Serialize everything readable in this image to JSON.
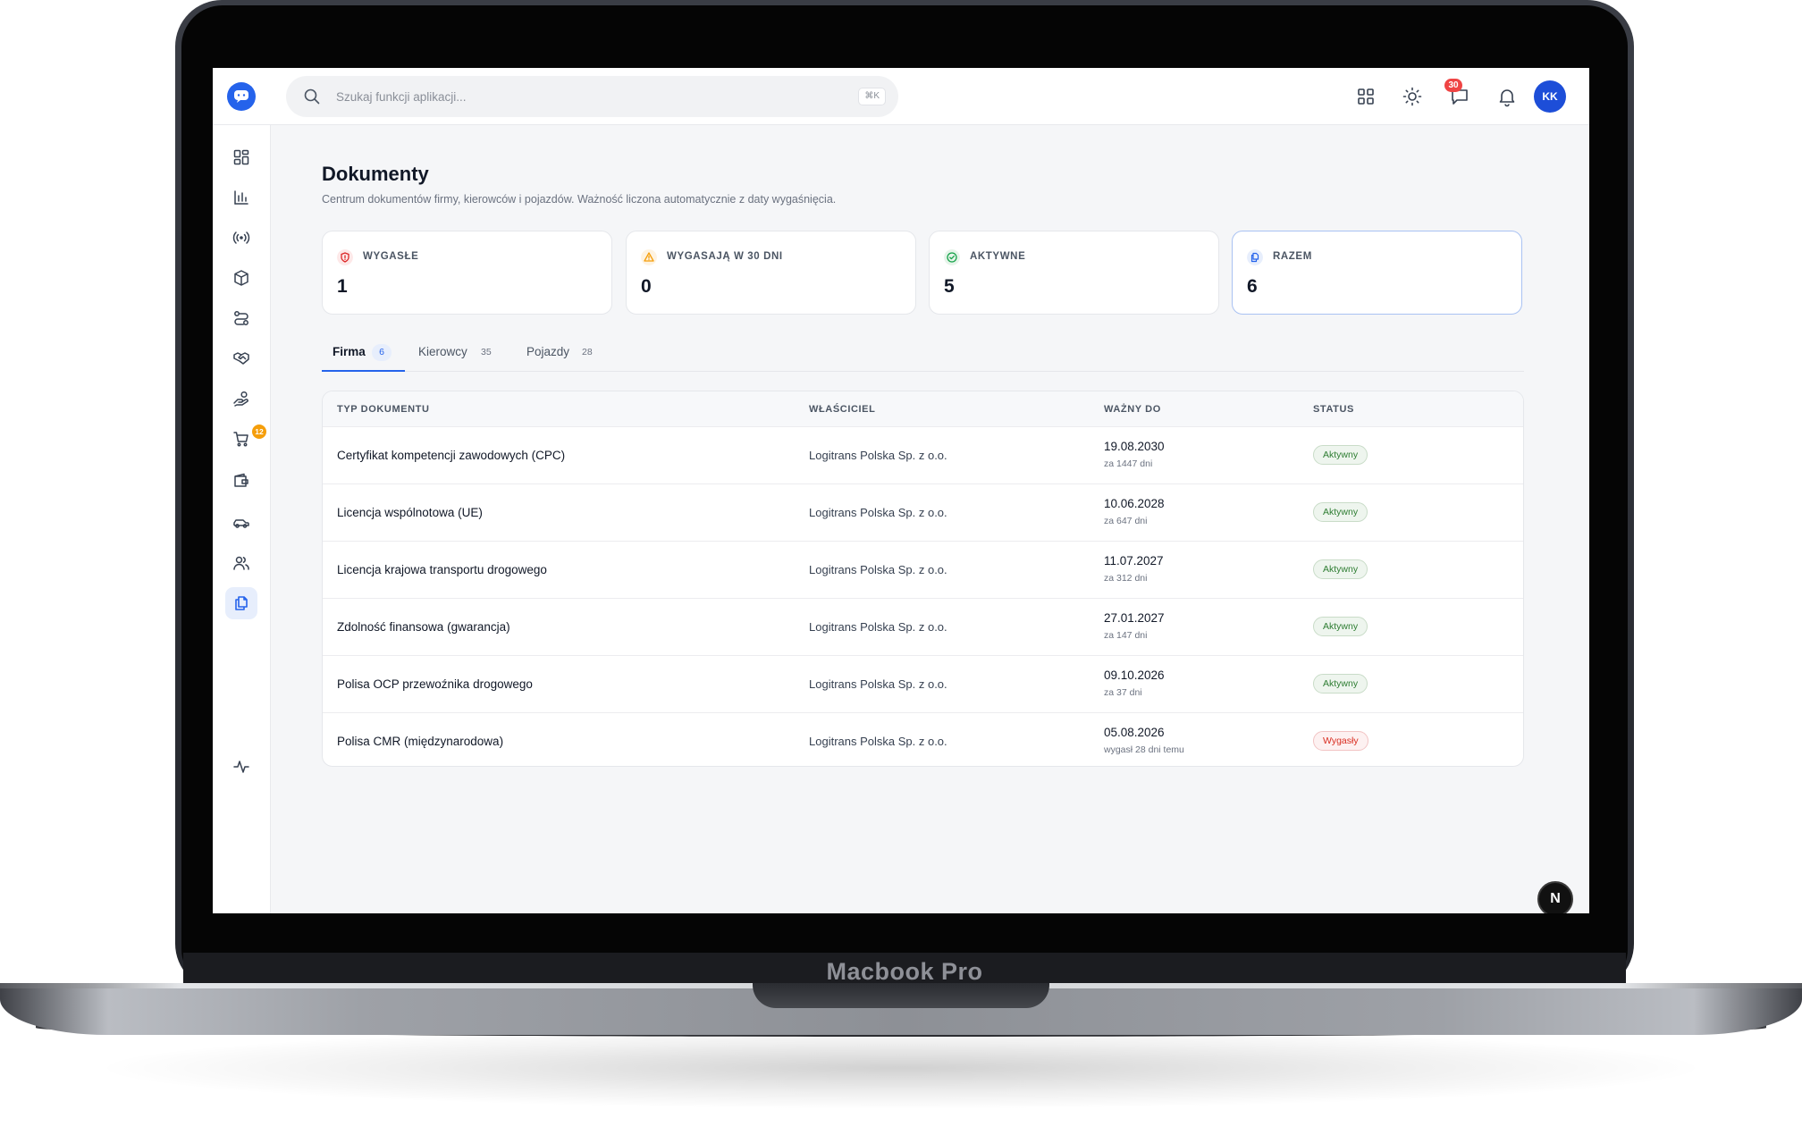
{
  "device": {
    "label": "Macbook Pro"
  },
  "search": {
    "placeholder": "Szukaj funkcji aplikacji...",
    "shortcut": "⌘K"
  },
  "header": {
    "notifications_count": "30",
    "avatar_initials": "KK"
  },
  "sidebar": {
    "items": [
      {
        "icon": "dashboard-grid-icon"
      },
      {
        "icon": "bar-chart-icon"
      },
      {
        "icon": "broadcast-icon"
      },
      {
        "icon": "package-icon"
      },
      {
        "icon": "route-icon"
      },
      {
        "icon": "handshake-icon"
      },
      {
        "icon": "hand-coins-icon"
      },
      {
        "icon": "cart-icon",
        "badge": "12"
      },
      {
        "icon": "wallet-icon"
      },
      {
        "icon": "car-icon"
      },
      {
        "icon": "users-icon"
      },
      {
        "icon": "documents-icon",
        "active": true
      },
      {
        "icon": "activity-icon"
      }
    ]
  },
  "page": {
    "title": "Dokumenty",
    "subtitle": "Centrum dokumentów firmy, kierowców i pojazdów. Ważność liczona automatycznie z daty wygaśnięcia."
  },
  "stats": [
    {
      "label": "WYGASŁE",
      "value": "1",
      "color": "#dc2626",
      "icon": "shield-alert-icon"
    },
    {
      "label": "WYGASAJĄ W 30 DNI",
      "value": "0",
      "color": "#f59e0b",
      "icon": "warning-icon"
    },
    {
      "label": "AKTYWNE",
      "value": "5",
      "color": "#16a34a",
      "icon": "check-circle-icon"
    },
    {
      "label": "RAZEM",
      "value": "6",
      "color": "#2563eb",
      "icon": "files-icon"
    }
  ],
  "tabs": [
    {
      "label": "Firma",
      "count": "6",
      "active": true
    },
    {
      "label": "Kierowcy",
      "count": "35"
    },
    {
      "label": "Pojazdy",
      "count": "28"
    }
  ],
  "table": {
    "columns": [
      "TYP DOKUMENTU",
      "WŁAŚCICIEL",
      "WAŻNY DO",
      "STATUS"
    ],
    "rows": [
      {
        "type": "Certyfikat kompetencji zawodowych (CPC)",
        "owner": "Logitrans Polska Sp. z o.o.",
        "date": "19.08.2030",
        "rel": "za 1447 dni",
        "status": "Aktywny"
      },
      {
        "type": "Licencja wspólnotowa (UE)",
        "owner": "Logitrans Polska Sp. z o.o.",
        "date": "10.06.2028",
        "rel": "za 647 dni",
        "status": "Aktywny"
      },
      {
        "type": "Licencja krajowa transportu drogowego",
        "owner": "Logitrans Polska Sp. z o.o.",
        "date": "11.07.2027",
        "rel": "za 312 dni",
        "status": "Aktywny"
      },
      {
        "type": "Zdolność finansowa (gwarancja)",
        "owner": "Logitrans Polska Sp. z o.o.",
        "date": "27.01.2027",
        "rel": "za 147 dni",
        "status": "Aktywny"
      },
      {
        "type": "Polisa OCP przewoźnika drogowego",
        "owner": "Logitrans Polska Sp. z o.o.",
        "date": "09.10.2026",
        "rel": "za 37 dni",
        "status": "Aktywny"
      },
      {
        "type": "Polisa CMR (międzynarodowa)",
        "owner": "Logitrans Polska Sp. z o.o.",
        "date": "05.08.2026",
        "rel": "wygasł 28 dni temu",
        "status": "Wygasły"
      }
    ]
  },
  "colors": {
    "accent": "#2563eb",
    "ok": "#2e7d32",
    "danger": "#d92d20"
  },
  "next_button": {
    "label": "N"
  }
}
